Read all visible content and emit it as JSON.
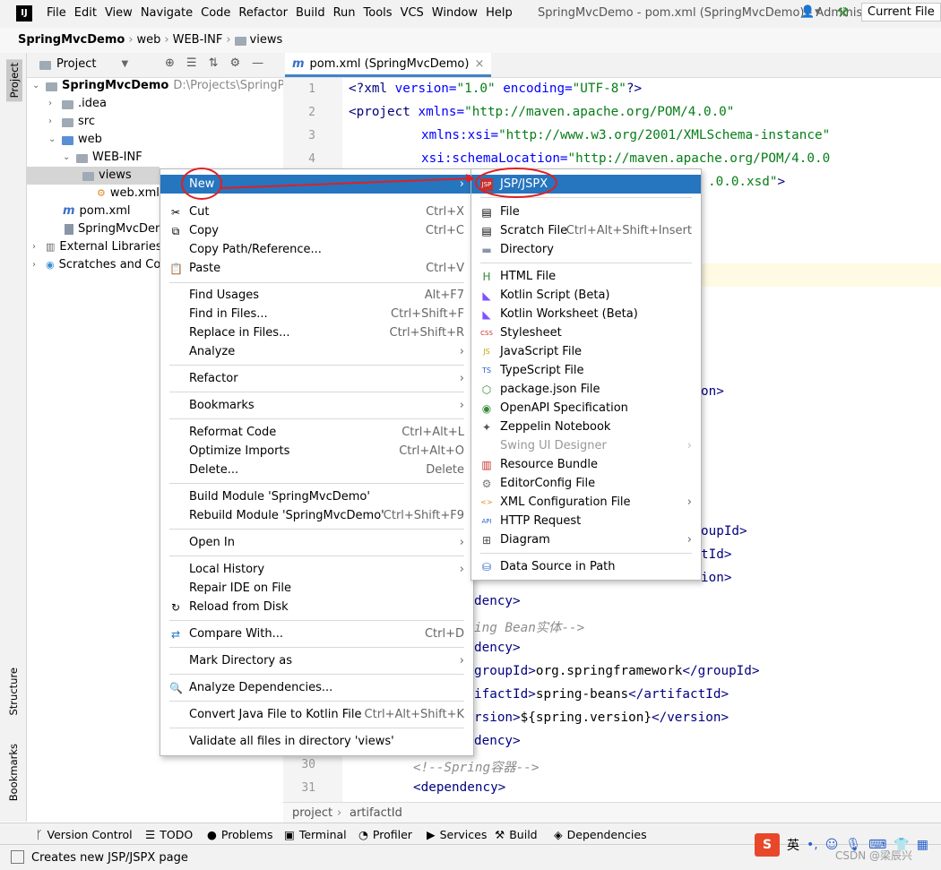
{
  "menubar": [
    "File",
    "Edit",
    "View",
    "Navigate",
    "Code",
    "Refactor",
    "Build",
    "Run",
    "Tools",
    "VCS",
    "Window",
    "Help"
  ],
  "window_title": "SpringMvcDemo - pom.xml (SpringMvcDemo) - Administrator",
  "breadcrumb": [
    "SpringMvcDemo",
    "web",
    "WEB-INF",
    "views"
  ],
  "run_config": "Current File",
  "left_tabs": {
    "project": "Project",
    "structure": "Structure",
    "bookmarks": "Bookmarks"
  },
  "project_panel": {
    "title": "Project",
    "tree": [
      {
        "label": "SpringMvcDemo",
        "path": "D:\\Projects\\SpringProje"
      },
      {
        "label": ".idea"
      },
      {
        "label": "src"
      },
      {
        "label": "web"
      },
      {
        "label": "WEB-INF"
      },
      {
        "label": "views"
      },
      {
        "label": "web.xml"
      },
      {
        "label": "pom.xml"
      },
      {
        "label": "SpringMvcDem"
      },
      {
        "label": "External Libraries"
      },
      {
        "label": "Scratches and Con"
      }
    ]
  },
  "editor": {
    "tab": "pom.xml (SpringMvcDemo)",
    "line_numbers": [
      "1",
      "2",
      "3",
      "4",
      "5",
      "30",
      "31"
    ],
    "crumbs": [
      "project",
      "artifactId"
    ]
  },
  "context_menu": {
    "items": [
      {
        "label": "New"
      },
      {
        "label": "Cut",
        "shortcut": "Ctrl+X"
      },
      {
        "label": "Copy",
        "shortcut": "Ctrl+C"
      },
      {
        "label": "Copy Path/Reference..."
      },
      {
        "label": "Paste",
        "shortcut": "Ctrl+V"
      },
      {
        "label": "Find Usages",
        "shortcut": "Alt+F7"
      },
      {
        "label": "Find in Files...",
        "shortcut": "Ctrl+Shift+F"
      },
      {
        "label": "Replace in Files...",
        "shortcut": "Ctrl+Shift+R"
      },
      {
        "label": "Analyze"
      },
      {
        "label": "Refactor"
      },
      {
        "label": "Bookmarks"
      },
      {
        "label": "Reformat Code",
        "shortcut": "Ctrl+Alt+L"
      },
      {
        "label": "Optimize Imports",
        "shortcut": "Ctrl+Alt+O"
      },
      {
        "label": "Delete...",
        "shortcut": "Delete"
      },
      {
        "label": "Build Module 'SpringMvcDemo'"
      },
      {
        "label": "Rebuild Module 'SpringMvcDemo'",
        "shortcut": "Ctrl+Shift+F9"
      },
      {
        "label": "Open In"
      },
      {
        "label": "Local History"
      },
      {
        "label": "Repair IDE on File"
      },
      {
        "label": "Reload from Disk"
      },
      {
        "label": "Compare With...",
        "shortcut": "Ctrl+D"
      },
      {
        "label": "Mark Directory as"
      },
      {
        "label": "Analyze Dependencies..."
      },
      {
        "label": "Convert Java File to Kotlin File",
        "shortcut": "Ctrl+Alt+Shift+K"
      },
      {
        "label": "Validate all files in directory 'views'"
      }
    ]
  },
  "new_submenu": {
    "items": [
      {
        "label": "JSP/JSPX"
      },
      {
        "label": "File"
      },
      {
        "label": "Scratch File",
        "shortcut": "Ctrl+Alt+Shift+Insert"
      },
      {
        "label": "Directory"
      },
      {
        "label": "HTML File"
      },
      {
        "label": "Kotlin Script (Beta)"
      },
      {
        "label": "Kotlin Worksheet (Beta)"
      },
      {
        "label": "Stylesheet"
      },
      {
        "label": "JavaScript File"
      },
      {
        "label": "TypeScript File"
      },
      {
        "label": "package.json File"
      },
      {
        "label": "OpenAPI Specification"
      },
      {
        "label": "Zeppelin Notebook"
      },
      {
        "label": "Swing UI Designer"
      },
      {
        "label": "Resource Bundle"
      },
      {
        "label": "EditorConfig File"
      },
      {
        "label": "XML Configuration File"
      },
      {
        "label": "HTTP Request"
      },
      {
        "label": "Diagram"
      },
      {
        "label": "Data Source in Path"
      }
    ]
  },
  "bottom_tools": [
    "Version Control",
    "TODO",
    "Problems",
    "Terminal",
    "Profiler",
    "Services",
    "Build",
    "Dependencies"
  ],
  "status": "Creates new JSP/JSPX page",
  "ime_label": "英",
  "watermark": "CSDN @梁辰兴",
  "colors": {
    "selection": "#2675bf",
    "annotation": "#e02020",
    "accent": "#4083c9"
  }
}
